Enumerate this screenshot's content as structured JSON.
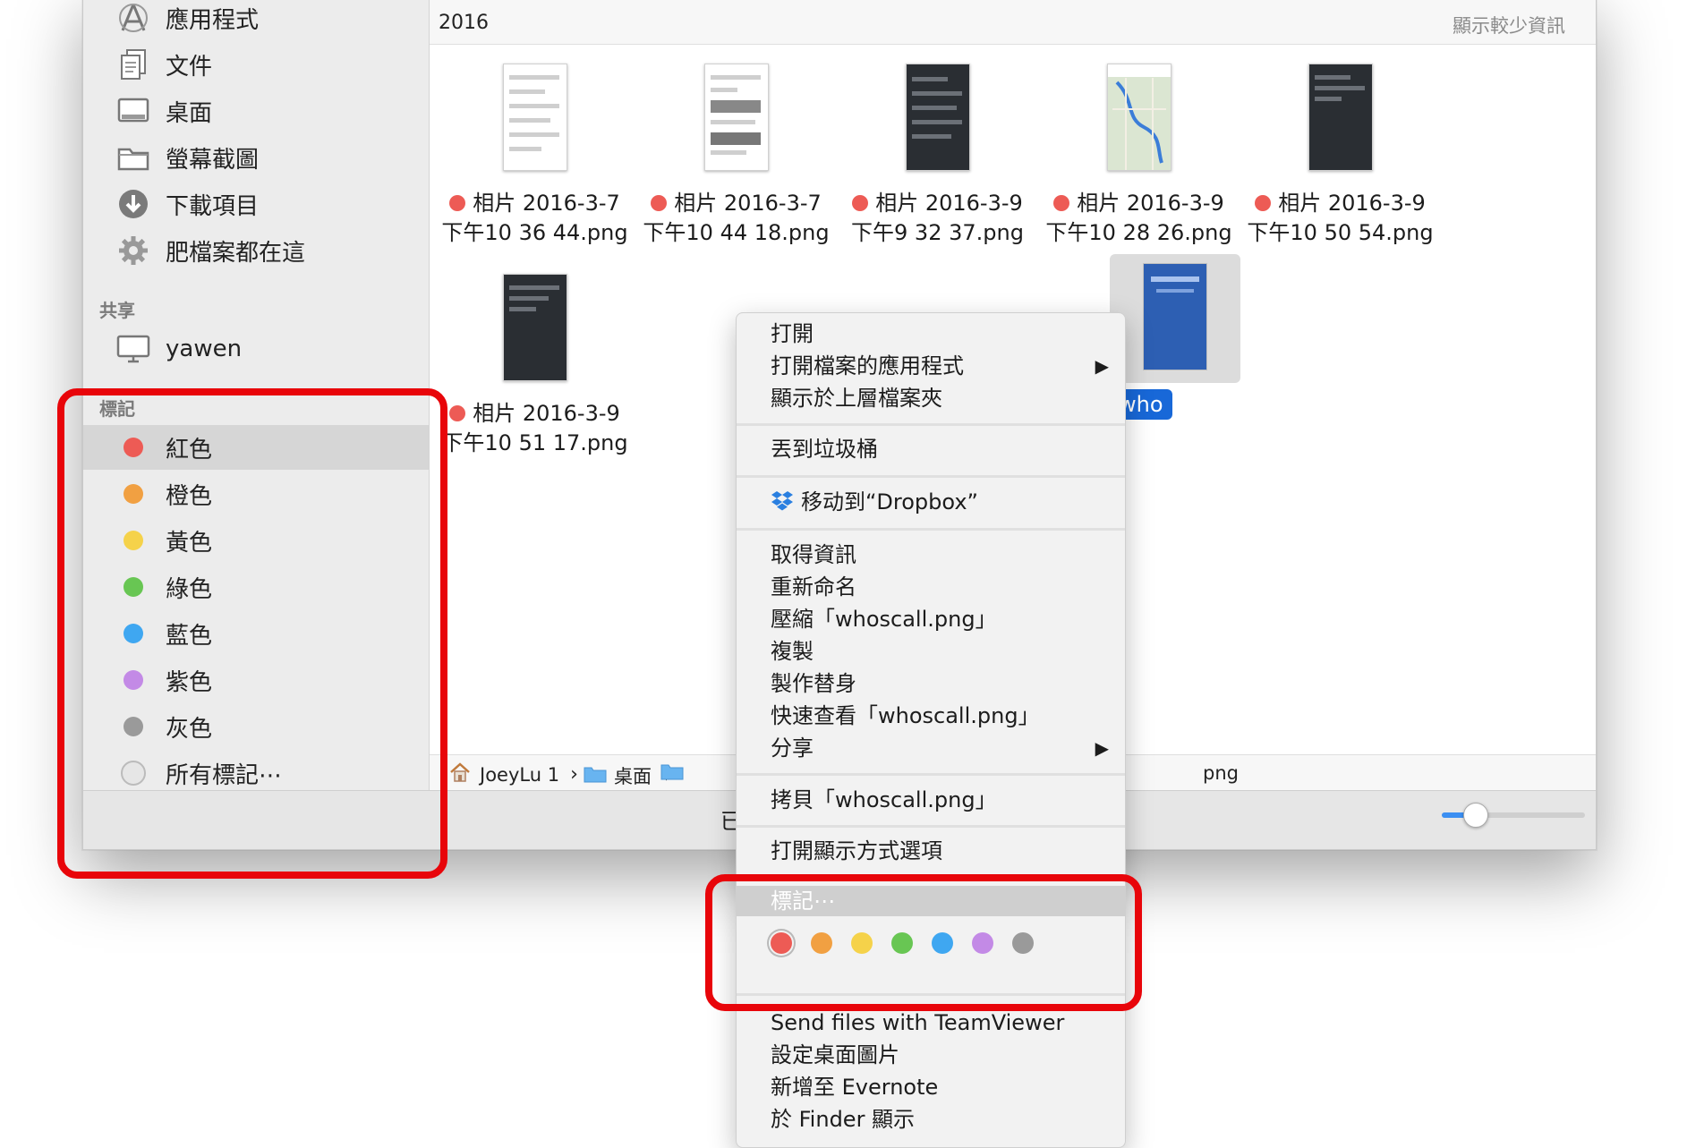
{
  "colors": {
    "red": "#ED5B55",
    "orange": "#F1A042",
    "yellow": "#F5D24A",
    "green": "#68C653",
    "blue": "#3FA7F1",
    "purple": "#C38AE6",
    "gray": "#9A9A9A",
    "highlight": "#E8050A",
    "selection": "#1868D8"
  },
  "sidebar": {
    "favorites": [
      {
        "label": "應用程式",
        "icon": "applications-icon"
      },
      {
        "label": "文件",
        "icon": "documents-icon"
      },
      {
        "label": "桌面",
        "icon": "desktop-icon"
      },
      {
        "label": "螢幕截圖",
        "icon": "folder-icon"
      },
      {
        "label": "下載項目",
        "icon": "downloads-icon"
      },
      {
        "label": "肥檔案都在這",
        "icon": "gear-icon"
      }
    ],
    "shared_header": "共享",
    "shared": [
      {
        "label": "yawen",
        "icon": "computer-icon"
      }
    ],
    "tags_header": "標記",
    "tags": [
      {
        "label": "紅色",
        "color": "#ED5B55"
      },
      {
        "label": "橙色",
        "color": "#F1A042"
      },
      {
        "label": "黃色",
        "color": "#F5D24A"
      },
      {
        "label": "綠色",
        "color": "#68C653"
      },
      {
        "label": "藍色",
        "color": "#3FA7F1"
      },
      {
        "label": "紫色",
        "color": "#C38AE6"
      },
      {
        "label": "灰色",
        "color": "#9A9A9A"
      },
      {
        "label": "所有標記⋯",
        "color": "#E6E6E6"
      }
    ]
  },
  "main": {
    "group_title": "2016",
    "show_less": "顯示較少資訊",
    "files": [
      {
        "line1": "相片 2016-3-7",
        "line2": "下午10 36 44.png",
        "style": "light"
      },
      {
        "line1": "相片 2016-3-7",
        "line2": "下午10 44 18.png",
        "style": "light"
      },
      {
        "line1": "相片 2016-3-9",
        "line2": "下午9 32 37.png",
        "style": "dark"
      },
      {
        "line1": "相片 2016-3-9",
        "line2": "下午10 28 26.png",
        "style": "map"
      },
      {
        "line1": "相片 2016-3-9",
        "line2": "下午10 50 54.png",
        "style": "dark"
      },
      {
        "line1": "相片 2016-3-9",
        "line2": "下午10 51 17.png",
        "style": "dark"
      }
    ],
    "selected_file": {
      "label": "who"
    },
    "pathbar": {
      "home": "JoeyLu 1",
      "folder": "桌面",
      "tail": "png"
    },
    "status_fragment": "已"
  },
  "context_menu": {
    "open": "打開",
    "open_with": "打開檔案的應用程式",
    "show_enclosing": "顯示於上層檔案夾",
    "trash": "丟到垃圾桶",
    "dropbox": "移动到“Dropbox”",
    "get_info": "取得資訊",
    "rename": "重新命名",
    "compress": "壓縮「whoscall.png」",
    "duplicate": "複製",
    "make_alias": "製作替身",
    "quick_look": "快速查看「whoscall.png」",
    "share": "分享",
    "copy": "拷貝「whoscall.png」",
    "view_options": "打開顯示方式選項",
    "tags": "標記⋯",
    "tag_colors": [
      "#ED5B55",
      "#F1A042",
      "#F5D24A",
      "#68C653",
      "#3FA7F1",
      "#C38AE6",
      "#9A9A9A"
    ],
    "teamviewer": "Send files with TeamViewer",
    "set_desktop": "設定桌面圖片",
    "evernote": "新增至 Evernote",
    "show_finder": "於 Finder 顯示"
  }
}
